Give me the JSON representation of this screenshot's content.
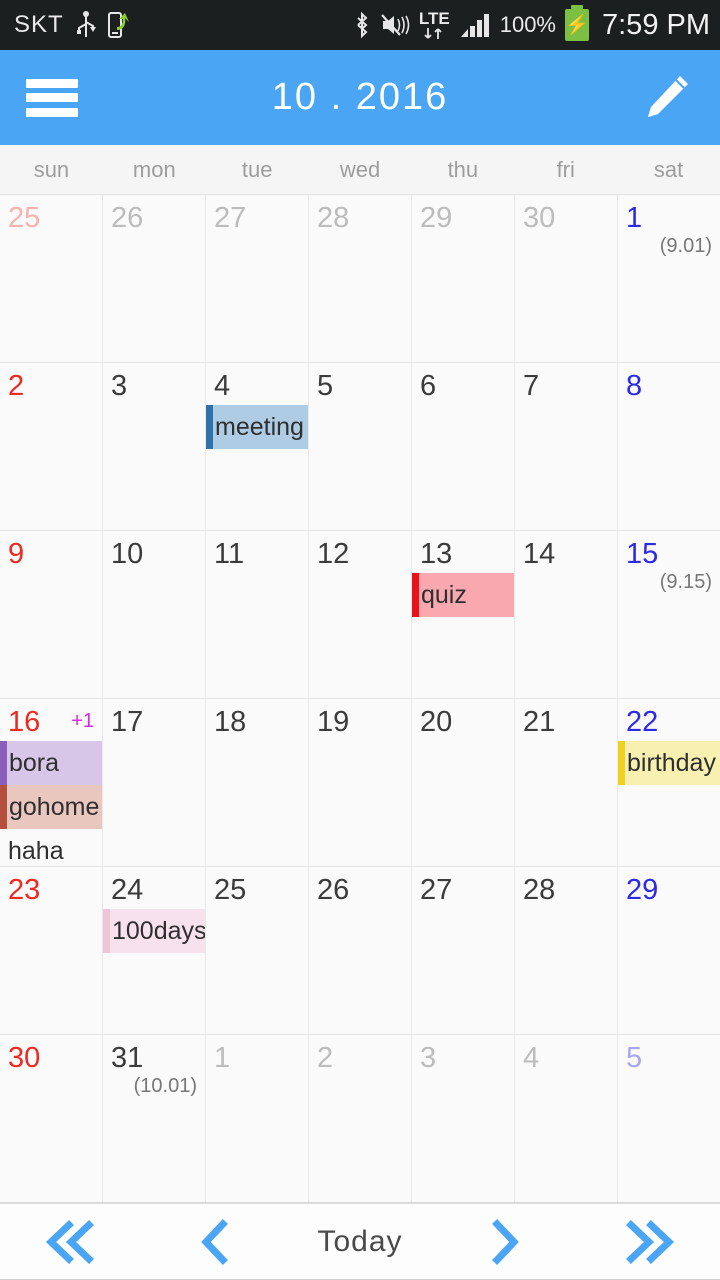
{
  "status_bar": {
    "carrier": "SKT",
    "icons_left": [
      "usb-icon",
      "phone-transfer-icon"
    ],
    "icons_right": [
      "bluetooth-icon",
      "mute-vibrate-icon",
      "lte-icon",
      "signal-bars-icon"
    ],
    "lte_label": "LTE",
    "battery_percent": "100%",
    "battery_state": "charging",
    "time": "7:59 PM"
  },
  "header": {
    "title": "10 . 2016",
    "menu_icon": "hamburger-icon",
    "edit_icon": "pencil-icon",
    "accent_color": "#4aa5f5"
  },
  "weekdays": [
    "sun",
    "mon",
    "tue",
    "wed",
    "thu",
    "fri",
    "sat"
  ],
  "calendar": {
    "weeks": [
      [
        {
          "num": "25",
          "type": "out",
          "weekday": "sun"
        },
        {
          "num": "26",
          "type": "out",
          "weekday": "mon"
        },
        {
          "num": "27",
          "type": "out",
          "weekday": "tue"
        },
        {
          "num": "28",
          "type": "out",
          "weekday": "wed"
        },
        {
          "num": "29",
          "type": "out",
          "weekday": "thu"
        },
        {
          "num": "30",
          "type": "out",
          "weekday": "fri"
        },
        {
          "num": "1",
          "type": "in",
          "weekday": "sat",
          "lunar": "(9.01)"
        }
      ],
      [
        {
          "num": "2",
          "type": "in",
          "weekday": "sun"
        },
        {
          "num": "3",
          "type": "in",
          "weekday": "mon"
        },
        {
          "num": "4",
          "type": "in",
          "weekday": "tue",
          "events": [
            {
              "title": "meeting",
              "bg": "#aecde5",
              "bar": "#2f72ab"
            }
          ]
        },
        {
          "num": "5",
          "type": "in",
          "weekday": "wed"
        },
        {
          "num": "6",
          "type": "in",
          "weekday": "thu"
        },
        {
          "num": "7",
          "type": "in",
          "weekday": "fri"
        },
        {
          "num": "8",
          "type": "in",
          "weekday": "sat"
        }
      ],
      [
        {
          "num": "9",
          "type": "in",
          "weekday": "sun"
        },
        {
          "num": "10",
          "type": "in",
          "weekday": "mon"
        },
        {
          "num": "11",
          "type": "in",
          "weekday": "tue"
        },
        {
          "num": "12",
          "type": "in",
          "weekday": "wed"
        },
        {
          "num": "13",
          "type": "in",
          "weekday": "thu",
          "events": [
            {
              "title": "quiz",
              "bg": "#f8a8ae",
              "bar": "#ea1119"
            }
          ]
        },
        {
          "num": "14",
          "type": "in",
          "weekday": "fri"
        },
        {
          "num": "15",
          "type": "in",
          "weekday": "sat",
          "lunar": "(9.15)"
        }
      ],
      [
        {
          "num": "16",
          "type": "in",
          "weekday": "sun",
          "badge": "+1",
          "events": [
            {
              "title": "bora",
              "bg": "#d7c6e8",
              "bar": "#8a5db8"
            },
            {
              "title": "gohome",
              "bg": "#e9c6be",
              "bar": "#b5503f"
            },
            {
              "title": "haha",
              "bg": "transparent",
              "bar": "transparent"
            }
          ]
        },
        {
          "num": "17",
          "type": "in",
          "weekday": "mon"
        },
        {
          "num": "18",
          "type": "in",
          "weekday": "tue"
        },
        {
          "num": "19",
          "type": "in",
          "weekday": "wed"
        },
        {
          "num": "20",
          "type": "in",
          "weekday": "thu"
        },
        {
          "num": "21",
          "type": "in",
          "weekday": "fri"
        },
        {
          "num": "22",
          "type": "in",
          "weekday": "sat",
          "events": [
            {
              "title": "birthday",
              "bg": "#f7f0b0",
              "bar": "#f0d020"
            }
          ]
        }
      ],
      [
        {
          "num": "23",
          "type": "in",
          "weekday": "sun"
        },
        {
          "num": "24",
          "type": "in",
          "weekday": "mon",
          "events": [
            {
              "title": "100days",
              "bg": "#f6e1ed",
              "bar": "#eec4d8"
            }
          ]
        },
        {
          "num": "25",
          "type": "in",
          "weekday": "tue"
        },
        {
          "num": "26",
          "type": "in",
          "weekday": "wed"
        },
        {
          "num": "27",
          "type": "in",
          "weekday": "thu"
        },
        {
          "num": "28",
          "type": "in",
          "weekday": "fri"
        },
        {
          "num": "29",
          "type": "in",
          "weekday": "sat"
        }
      ],
      [
        {
          "num": "30",
          "type": "in",
          "weekday": "sun"
        },
        {
          "num": "31",
          "type": "in",
          "weekday": "mon",
          "lunar": "(10.01)"
        },
        {
          "num": "1",
          "type": "out",
          "weekday": "tue"
        },
        {
          "num": "2",
          "type": "out",
          "weekday": "wed"
        },
        {
          "num": "3",
          "type": "out",
          "weekday": "thu"
        },
        {
          "num": "4",
          "type": "out",
          "weekday": "fri"
        },
        {
          "num": "5",
          "type": "out",
          "weekday": "sat"
        }
      ]
    ]
  },
  "bottom_nav": {
    "first_icon": "double-chevron-left-icon",
    "prev_icon": "chevron-left-icon",
    "today_label": "Today",
    "next_icon": "chevron-right-icon",
    "last_icon": "double-chevron-right-icon",
    "chevron_color": "#4aa5f5"
  }
}
